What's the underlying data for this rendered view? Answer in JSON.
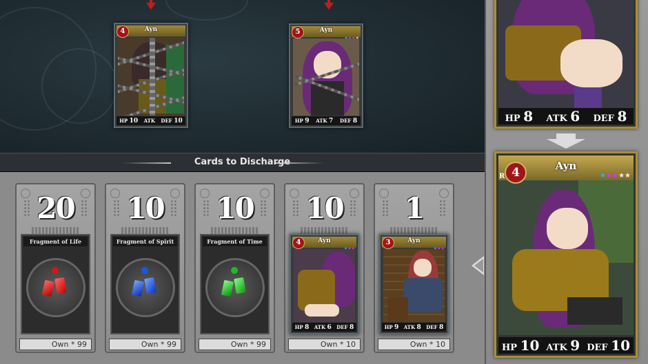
{
  "banner": {
    "title": "Cards to Discharge"
  },
  "top_cards": [
    {
      "name": "Ayn",
      "level": "4",
      "hp": "10",
      "atk": "",
      "def": "10",
      "hp_label": "HP",
      "atk_label": "ATK",
      "def_label": "DEF"
    },
    {
      "name": "Ayn",
      "level": "5",
      "hp": "9",
      "atk": "7",
      "def": "8",
      "hp_label": "HP",
      "atk_label": "ATK",
      "def_label": "DEF"
    }
  ],
  "discharge_cards": [
    {
      "count": "20",
      "title": "Fragment of Life",
      "own": "Own * 99",
      "gem_color": "#e01818"
    },
    {
      "count": "10",
      "title": "Fragment of Spirit",
      "own": "Own * 99",
      "gem_color": "#1a58e0"
    },
    {
      "count": "10",
      "title": "Fragment of Time",
      "own": "Own * 99",
      "gem_color": "#22b822"
    },
    {
      "count": "10",
      "name": "Ayn",
      "level": "4",
      "hp": "8",
      "atk": "6",
      "def": "8",
      "own": "Own * 10"
    },
    {
      "count": "1",
      "name": "Ayn",
      "level": "3",
      "hp": "9",
      "atk": "8",
      "def": "8",
      "own": "Own * 10"
    }
  ],
  "preview_top": {
    "hp_label": "HP",
    "hp": "8",
    "atk_label": "ATK",
    "atk": "6",
    "def_label": "DEF",
    "def": "8"
  },
  "preview_main": {
    "name": "Ayn",
    "rarity": "R",
    "level": "4",
    "hp_label": "HP",
    "hp": "10",
    "atk_label": "ATK",
    "atk": "9",
    "def_label": "DEF",
    "def": "10"
  },
  "colors": {
    "accent_red": "#c21d1d",
    "panel_gray": "#9a9a9a",
    "gold_frame": "#aa9030"
  }
}
